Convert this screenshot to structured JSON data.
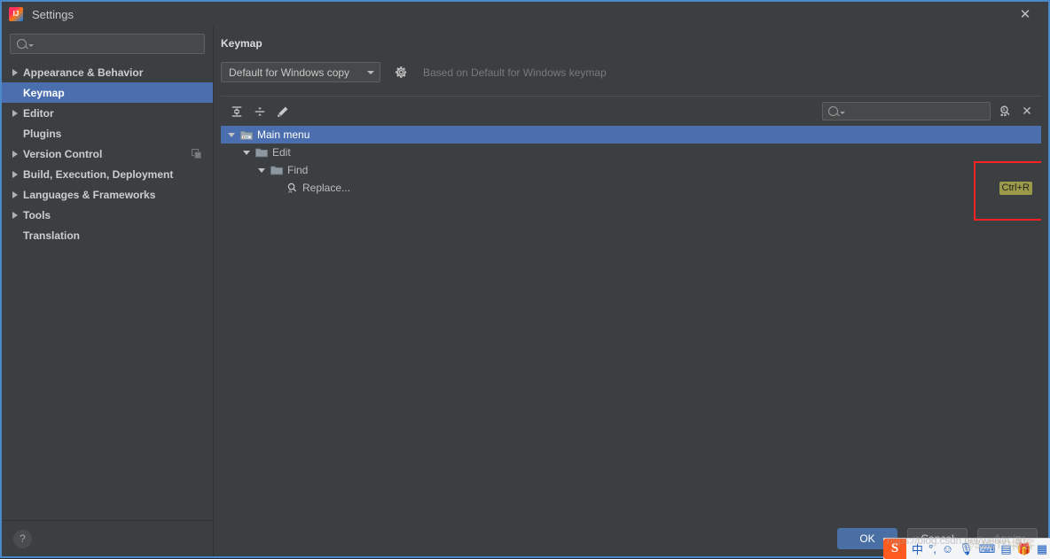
{
  "window": {
    "title": "Settings",
    "app_icon": "intellij-idea-icon",
    "close_icon": "close-icon"
  },
  "sidebar": {
    "search": {
      "placeholder": "",
      "value": "",
      "icon": "search-icon"
    },
    "items": [
      {
        "label": "Appearance & Behavior",
        "expandable": true,
        "selected": false,
        "trailing_icon": ""
      },
      {
        "label": "Keymap",
        "expandable": false,
        "selected": true,
        "trailing_icon": ""
      },
      {
        "label": "Editor",
        "expandable": true,
        "selected": false,
        "trailing_icon": ""
      },
      {
        "label": "Plugins",
        "expandable": false,
        "selected": false,
        "trailing_icon": ""
      },
      {
        "label": "Version Control",
        "expandable": true,
        "selected": false,
        "trailing_icon": "copy-icon"
      },
      {
        "label": "Build, Execution, Deployment",
        "expandable": true,
        "selected": false,
        "trailing_icon": ""
      },
      {
        "label": "Languages & Frameworks",
        "expandable": true,
        "selected": false,
        "trailing_icon": ""
      },
      {
        "label": "Tools",
        "expandable": true,
        "selected": false,
        "trailing_icon": ""
      },
      {
        "label": "Translation",
        "expandable": false,
        "selected": false,
        "trailing_icon": ""
      }
    ],
    "help_label": "?"
  },
  "main": {
    "page_title": "Keymap",
    "keymap_select": {
      "value": "Default for Windows copy",
      "caret_icon": "chevron-down-icon"
    },
    "gear_icon": "gear-icon",
    "based_on_text": "Based on Default for Windows keymap",
    "toolbar": {
      "expand_all_label": "expand-all",
      "collapse_all_label": "collapse-all",
      "edit_label": "edit-shortcut",
      "search": {
        "placeholder": "",
        "value": "",
        "icon": "search-icon"
      },
      "find_by_shortcut_label": "find-actions-by-shortcut",
      "clear_label": "clear-filter"
    },
    "tree": [
      {
        "label": "Main menu",
        "depth": 0,
        "expanded": true,
        "selected": true,
        "icon": "main-menu-icon",
        "shortcut": ""
      },
      {
        "label": "Edit",
        "depth": 1,
        "expanded": true,
        "selected": false,
        "icon": "folder-icon",
        "shortcut": ""
      },
      {
        "label": "Find",
        "depth": 2,
        "expanded": true,
        "selected": false,
        "icon": "folder-icon",
        "shortcut": ""
      },
      {
        "label": "Replace...",
        "depth": 3,
        "expanded": false,
        "selected": false,
        "icon": "action-icon",
        "shortcut": "Ctrl+R"
      }
    ],
    "highlight_color": "#ff2020",
    "shortcut_badge_color": "#9a9a4a"
  },
  "footer": {
    "ok_label": "OK",
    "cancel_label": "Cancel",
    "apply_label": "Apply"
  },
  "ime": {
    "logo": "S",
    "items": [
      "中",
      "°,",
      "☺",
      "🎙",
      "⌨",
      "▤",
      "🎁",
      "▦"
    ],
    "watermark": "https://blog.csdn.net/weixin_51",
    "watermark2": "@51CTO博客"
  }
}
